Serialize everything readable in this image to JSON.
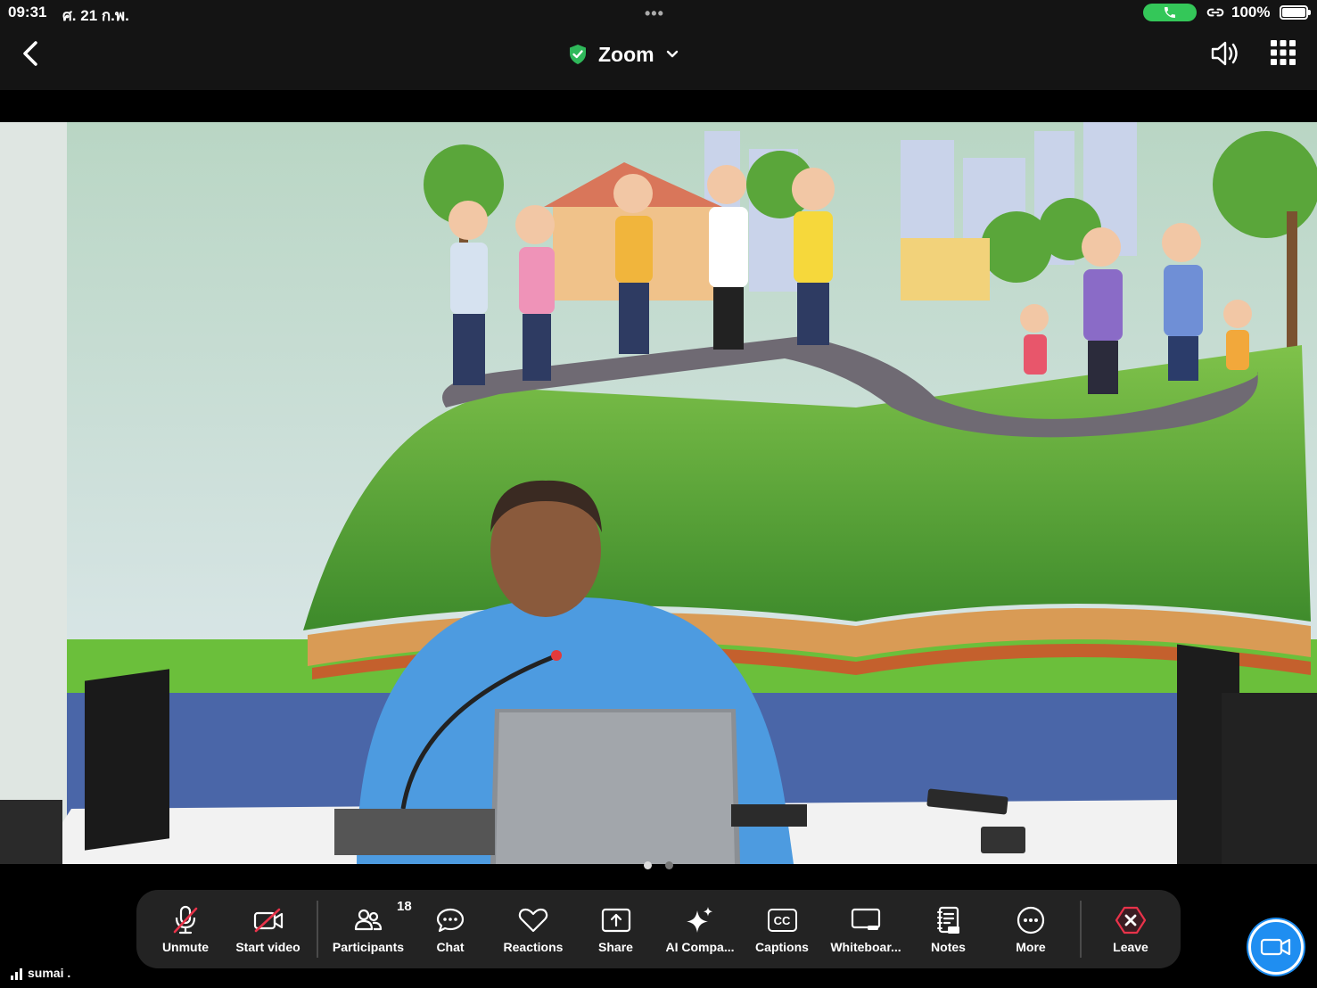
{
  "status_bar": {
    "time": "09:31",
    "date": "ศ. 21 ก.พ.",
    "battery": "100%"
  },
  "header": {
    "title": "Zoom"
  },
  "toolbar": {
    "unmute": "Unmute",
    "start_video": "Start video",
    "participants": "Participants",
    "participants_count": "18",
    "chat": "Chat",
    "reactions": "Reactions",
    "share": "Share",
    "ai_companion": "AI Compa...",
    "captions": "Captions",
    "captions_icon_text": "CC",
    "whiteboard": "Whiteboar...",
    "notes": "Notes",
    "more": "More",
    "leave": "Leave"
  },
  "network": {
    "user_name": "sumai ."
  },
  "colors": {
    "accent_blue": "#1f8ef1",
    "leave_red": "#e8334a",
    "secure_green": "#2fb85a",
    "call_green": "#34c759",
    "toolbar_bg": "#232323"
  },
  "icons": [
    "chevron-left-icon",
    "shield-check-icon",
    "chevron-down-icon",
    "speaker-icon",
    "grid-icon",
    "mic-muted-icon",
    "video-off-icon",
    "participants-icon",
    "chat-icon",
    "heart-icon",
    "share-icon",
    "sparkle-icon",
    "cc-icon",
    "whiteboard-icon",
    "notes-icon",
    "more-icon",
    "leave-icon",
    "camera-icon"
  ]
}
